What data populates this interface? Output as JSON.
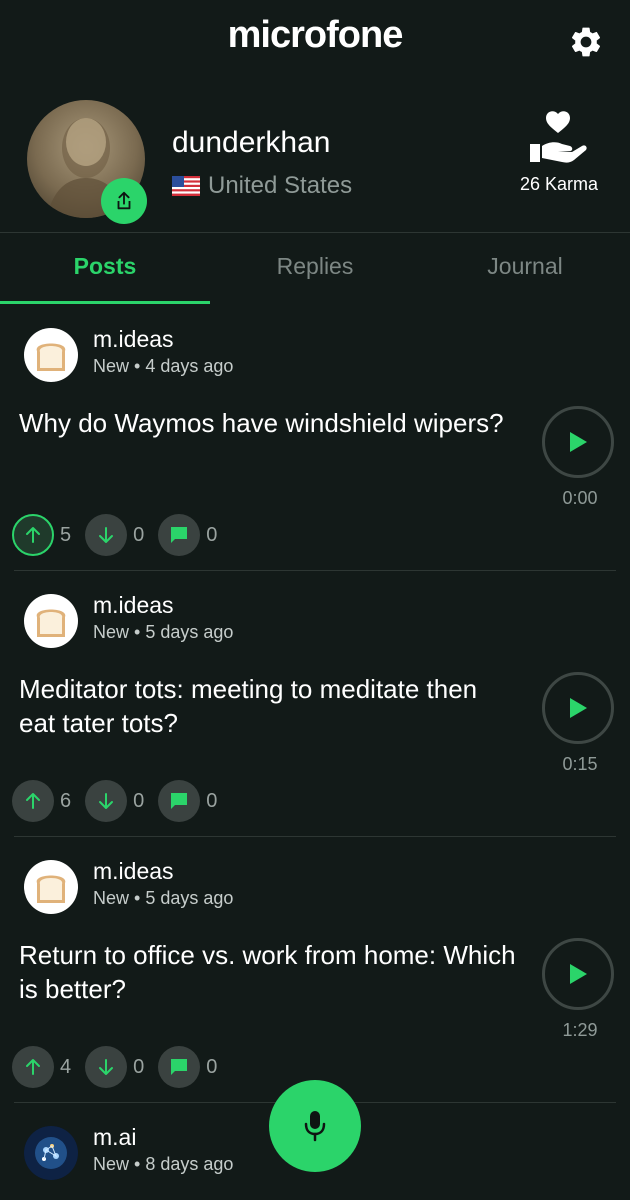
{
  "app": {
    "title": "microfone"
  },
  "profile": {
    "username": "dunderkhan",
    "country": "United States",
    "karma": "26 Karma"
  },
  "tabs": [
    {
      "label": "Posts",
      "active": true
    },
    {
      "label": "Replies",
      "active": false
    },
    {
      "label": "Journal",
      "active": false
    }
  ],
  "posts": [
    {
      "author": "m.ideas",
      "meta": "New • 4 days ago",
      "title": "Why do Waymos have windshield wipers?",
      "duration": "0:00",
      "upvotes": "5",
      "downvotes": "0",
      "comments": "0",
      "upvoted": true,
      "avatar_icon": "bread-icon"
    },
    {
      "author": "m.ideas",
      "meta": "New • 5 days ago",
      "title": "Meditator tots: meeting to meditate then eat tater tots?",
      "duration": "0:15",
      "upvotes": "6",
      "downvotes": "0",
      "comments": "0",
      "upvoted": false,
      "avatar_icon": "bread-icon"
    },
    {
      "author": "m.ideas",
      "meta": "New • 5 days ago",
      "title": "Return to office vs. work from home: Which is better?",
      "duration": "1:29",
      "upvotes": "4",
      "downvotes": "0",
      "comments": "0",
      "upvoted": false,
      "avatar_icon": "bread-icon"
    },
    {
      "author": "m.ai",
      "meta": "New • 8 days ago",
      "avatar_icon": "brain-network-icon"
    }
  ],
  "colors": {
    "accent": "#2bd46a",
    "background": "#121a18",
    "muted": "#8f9a97"
  }
}
